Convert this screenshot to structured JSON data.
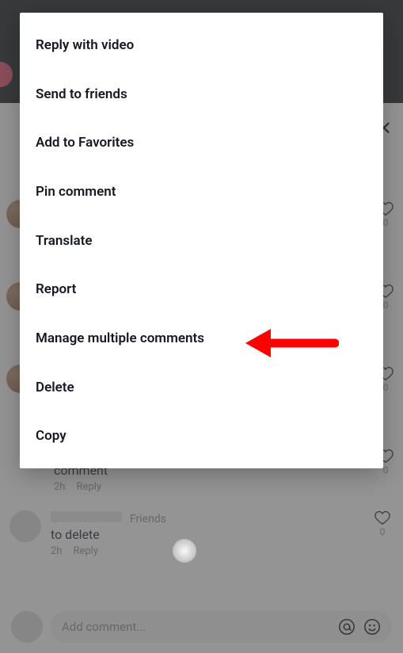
{
  "popup": {
    "items": [
      "Reply with video",
      "Send to friends",
      "Add to Favorites",
      "Pin comment",
      "Translate",
      "Report",
      "Manage multiple comments",
      "Delete",
      "Copy"
    ]
  },
  "background": {
    "close_icon": "✕",
    "side_hearts": {
      "count": "0"
    },
    "comment_tail": {
      "text": "comment",
      "time": "2h",
      "reply": "Reply"
    },
    "comment2": {
      "badge": "Friends",
      "text": "to delete",
      "time": "2h",
      "reply": "Reply",
      "like_count": "0"
    },
    "input": {
      "placeholder": "Add comment..."
    }
  },
  "annotation": {
    "arrow_target": "Manage multiple comments"
  }
}
